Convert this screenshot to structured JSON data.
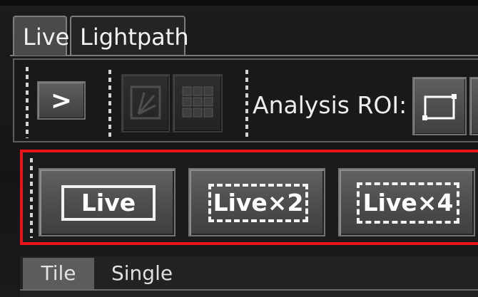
{
  "tabs": [
    {
      "label": "Live",
      "active": true
    },
    {
      "label": "Lightpath",
      "active": false
    }
  ],
  "toolbar": {
    "play_button": {
      "glyph": ">",
      "icon": "chevron-right-icon"
    },
    "image_tools": [
      {
        "icon": "image-adjust-icon",
        "enabled": false
      },
      {
        "icon": "grid-icon",
        "enabled": false
      }
    ],
    "analysis_roi": {
      "label": "Analysis ROI:",
      "icon": "roi-rectangle-icon"
    }
  },
  "live_modes": [
    {
      "label": "Live",
      "border": "solid"
    },
    {
      "label": "Live×2",
      "border": "dashed"
    },
    {
      "label": "Live×4",
      "border": "dashed"
    }
  ],
  "view_tabs": [
    {
      "label": "Tile",
      "active": true
    },
    {
      "label": "Single",
      "active": false
    }
  ],
  "colors": {
    "highlight": "#e8141a",
    "button_face": "#4f4f4f",
    "background": "#161616",
    "text": "#ffffff"
  }
}
